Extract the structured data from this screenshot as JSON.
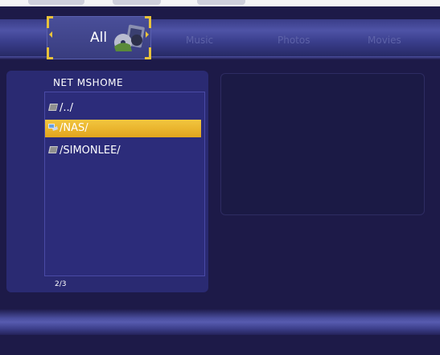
{
  "tabs": [
    {
      "label": "All",
      "icon": "media-icon",
      "active": true
    },
    {
      "label": "Music",
      "active": false
    },
    {
      "label": "Photos",
      "active": false
    },
    {
      "label": "Movies",
      "active": false
    }
  ],
  "browser": {
    "title": "NET  MSHOME",
    "items": [
      {
        "label": "/../",
        "icon": "folder-icon",
        "selected": false
      },
      {
        "label": "/NAS/",
        "icon": "network-drive-icon",
        "selected": true
      },
      {
        "label": "/SIMONLEE/",
        "icon": "folder-icon",
        "selected": false
      }
    ],
    "position": "2/3"
  },
  "colors": {
    "background": "#1d1a48",
    "panel": "#2a2a72",
    "selection": "#eab52c",
    "inactive_tab_text": "#5d62a8",
    "accent": "#e8c23a"
  }
}
